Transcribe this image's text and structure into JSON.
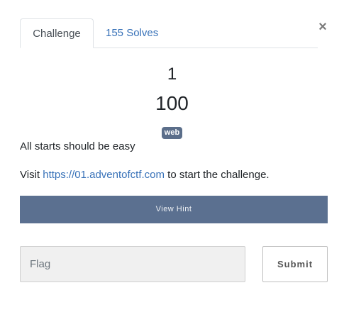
{
  "tabs": {
    "challenge_label": "Challenge",
    "solves_label": "155 Solves"
  },
  "close_symbol": "×",
  "challenge": {
    "name": "1",
    "value": "100",
    "category": "web",
    "description": "All starts should be easy",
    "visit_prefix": "Visit ",
    "link_text": "https://01.adventofctf.com",
    "visit_suffix": " to start the challenge."
  },
  "hint_label": "View Hint",
  "flag_placeholder": "Flag",
  "submit_label": "Submit",
  "colors": {
    "hint_button_bg": "#5b7090",
    "badge_bg": "#5b6e8a",
    "link": "#3771b8"
  }
}
